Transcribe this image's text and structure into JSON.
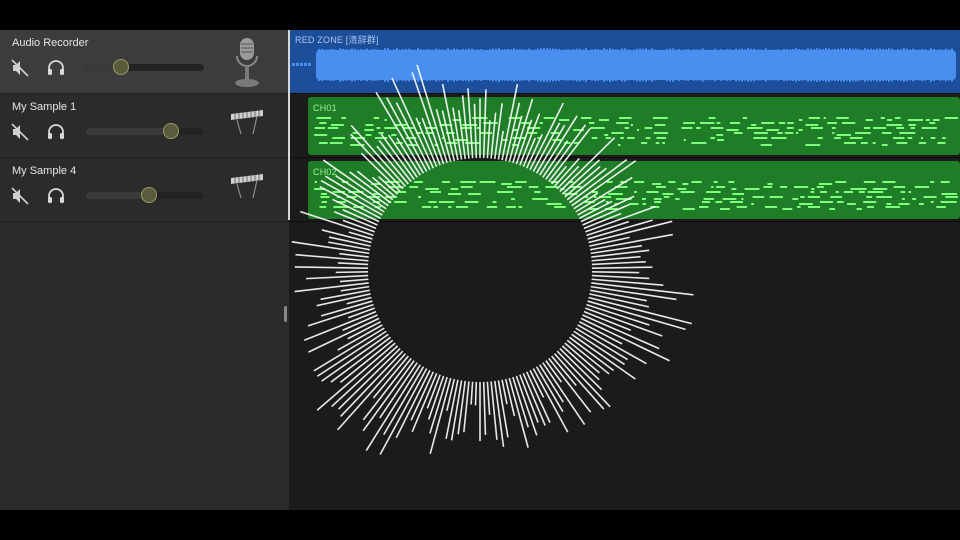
{
  "tracks": [
    {
      "name": "Audio Recorder",
      "volume": 0.3,
      "instrument_icon": "microphone-icon",
      "selected": true
    },
    {
      "name": "My Sample 1",
      "volume": 0.72,
      "instrument_icon": "keyboard-icon",
      "selected": false
    },
    {
      "name": "My Sample 4",
      "volume": 0.53,
      "instrument_icon": "keyboard-icon",
      "selected": false
    }
  ],
  "regions": {
    "audio": {
      "name": "RED ZONE [清辞群]"
    },
    "midi": [
      {
        "name": "CH01"
      },
      {
        "name": "CH02"
      }
    ]
  },
  "icons": {
    "mute": "speaker-muted-icon",
    "solo": "headphones-icon"
  },
  "colors": {
    "audio_lane": "#1d4e9a",
    "audio_wave": "#4a8ef0",
    "midi_region": "#1f7d28",
    "midi_note": "#7dff7a",
    "visualizer": "#ffffff"
  }
}
